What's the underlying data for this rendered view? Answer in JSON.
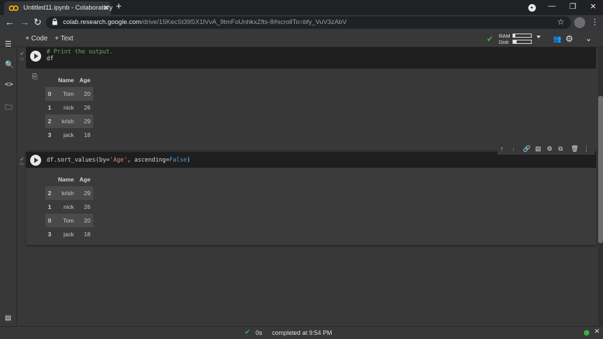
{
  "browser": {
    "tab_title": "Untitled11.ipynb - Colaboratory",
    "tab_close": "✕",
    "new_tab": "+",
    "url_host": "colab.research.google.com",
    "url_path": "/drive/15KecSt39SX1lVvA_9tmFoUnhkxZfts-8#scrollTo=bfy_VuV3zAbV",
    "icons": [
      "back-icon",
      "forward-icon",
      "reload-icon",
      "lock-icon",
      "star-icon",
      "avatar",
      "menu-icon"
    ]
  },
  "window": {
    "minimize": "—",
    "maximize": "❐",
    "close": "✕"
  },
  "colab_toolbar": {
    "add_code": "+ Code",
    "add_text": "+ Text",
    "ram_label": "RAM",
    "disk_label": "Disk",
    "ram_usage": 0.12,
    "disk_usage": 0.2,
    "accent_green": "#3fae49"
  },
  "cells": [
    {
      "comment": "# Print the output.",
      "code": "df",
      "output": {
        "columns": [
          "",
          "Name",
          "Age"
        ],
        "rows": [
          {
            "index": "0",
            "name": "Tom",
            "age": "20"
          },
          {
            "index": "1",
            "name": "nick",
            "age": "26"
          },
          {
            "index": "2",
            "name": "krish",
            "age": "29"
          },
          {
            "index": "3",
            "name": "jack",
            "age": "18"
          }
        ]
      }
    },
    {
      "code_prefix": "df.sort_values(by=",
      "code_str": "'Age'",
      "code_mid": ", ascending=",
      "code_kw": "False",
      "code_suffix": ")",
      "output": {
        "columns": [
          "",
          "Name",
          "Age"
        ],
        "rows": [
          {
            "index": "2",
            "name": "krish",
            "age": "29"
          },
          {
            "index": "1",
            "name": "nick",
            "age": "26"
          },
          {
            "index": "0",
            "name": "Tom",
            "age": "20"
          },
          {
            "index": "3",
            "name": "jack",
            "age": "18"
          }
        ]
      }
    }
  ],
  "status": {
    "time": "0s",
    "text": "completed at 9:54 PM"
  }
}
